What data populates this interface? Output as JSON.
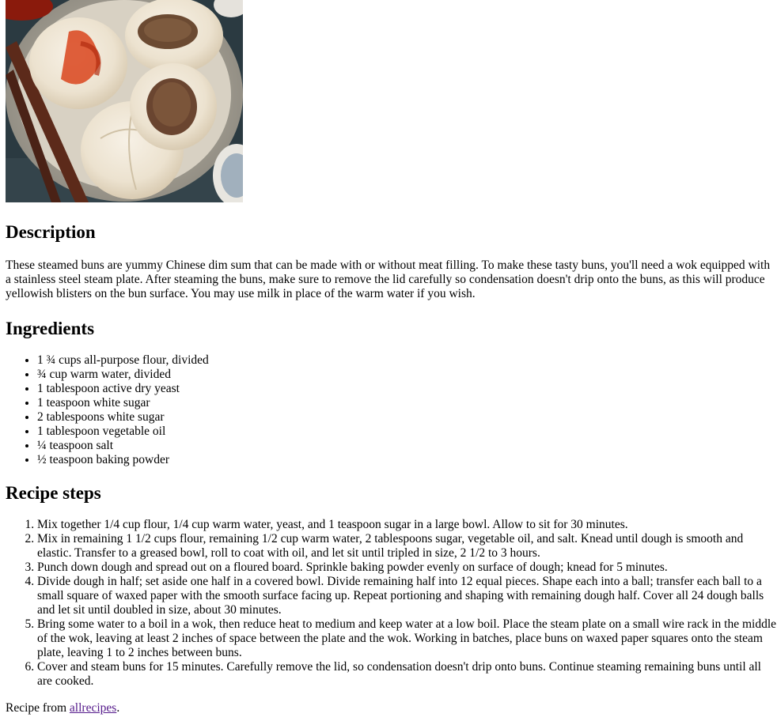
{
  "sections": {
    "description_heading": "Description",
    "ingredients_heading": "Ingredients",
    "steps_heading": "Recipe steps"
  },
  "description": "These steamed buns are yummy Chinese dim sum that can be made with or without meat filling. To make these tasty buns, you'll need a wok equipped with a stainless steel steam plate. After steaming the buns, make sure to remove the lid carefully so condensation doesn't drip onto the buns, as this will produce yellowish blisters on the bun surface. You may use milk in place of the warm water if you wish.",
  "ingredients": [
    "1 ¾ cups all-purpose flour, divided",
    "¾ cup warm water, divided",
    "1 tablespoon active dry yeast",
    "1 teaspoon white sugar",
    "2 tablespoons white sugar",
    "1 tablespoon vegetable oil",
    "¼ teaspoon salt",
    "½ teaspoon baking powder"
  ],
  "steps": [
    "Mix together 1/4 cup flour, 1/4 cup warm water, yeast, and 1 teaspoon sugar in a large bowl. Allow to sit for 30 minutes.",
    "Mix in remaining 1 1/2 cups flour, remaining 1/2 cup warm water, 2 tablespoons sugar, vegetable oil, and salt. Knead until dough is smooth and elastic. Transfer to a greased bowl, roll to coat with oil, and let sit until tripled in size, 2 1/2 to 3 hours.",
    "Punch down dough and spread out on a floured board. Sprinkle baking powder evenly on surface of dough; knead for 5 minutes.",
    "Divide dough in half; set aside one half in a covered bowl. Divide remaining half into 12 equal pieces. Shape each into a ball; transfer each ball to a small square of waxed paper with the smooth surface facing up. Repeat portioning and shaping with remaining dough half. Cover all 24 dough balls and let sit until doubled in size, about 30 minutes.",
    "Bring some water to a boil in a wok, then reduce heat to medium and keep water at a low boil. Place the steam plate on a small wire rack in the middle of the wok, leaving at least 2 inches of space between the plate and the wok. Working in batches, place buns on waxed paper squares onto the steam plate, leaving 1 to 2 inches between buns.",
    "Cover and steam buns for 15 minutes. Carefully remove the lid, so condensation doesn't drip onto buns. Continue steaming remaining buns until all are cooked."
  ],
  "source": {
    "prefix": "Recipe from ",
    "link_text": "allrecipes",
    "suffix": "."
  },
  "colors": {
    "link_visited": "#551a8b",
    "photo_background": "#27343a",
    "bun": "#efe6d6"
  }
}
